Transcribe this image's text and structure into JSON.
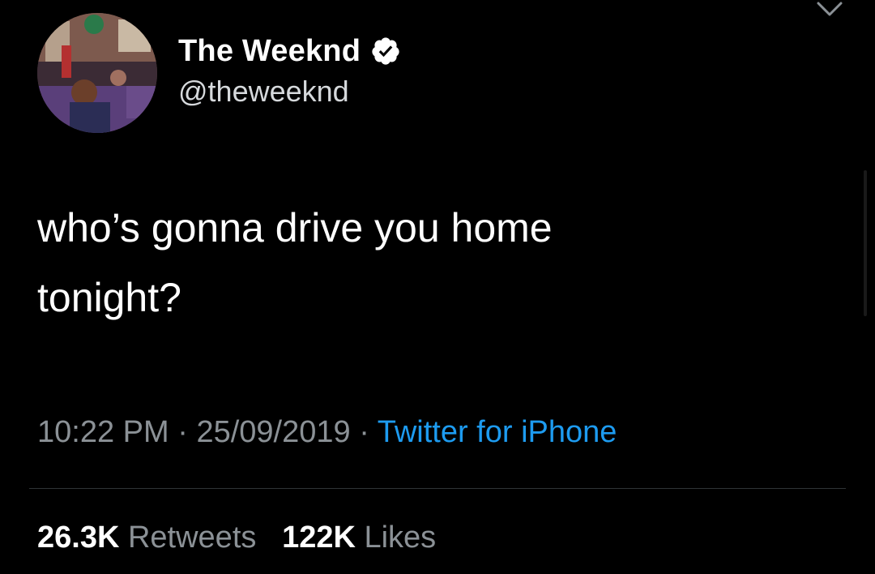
{
  "tweet": {
    "author": {
      "display_name": "The Weeknd",
      "handle": "@theweeknd",
      "verified_icon": "verified-badge-icon"
    },
    "text_line1": "who’s gonna drive you home",
    "text_line2": "tonight?",
    "time": "10:22 PM",
    "separator": "·",
    "date": "25/09/2019",
    "source": "Twitter for iPhone",
    "retweets_count": "26.3K",
    "retweets_label": "Retweets",
    "likes_count": "122K",
    "likes_label": "Likes"
  },
  "icons": {
    "menu": "chevron-down-icon",
    "verified": "verified-badge-icon"
  },
  "colors": {
    "background": "#000000",
    "text_primary": "#ffffff",
    "text_secondary": "#8b9196",
    "link": "#1d9bf0",
    "divider": "#2f3336"
  }
}
